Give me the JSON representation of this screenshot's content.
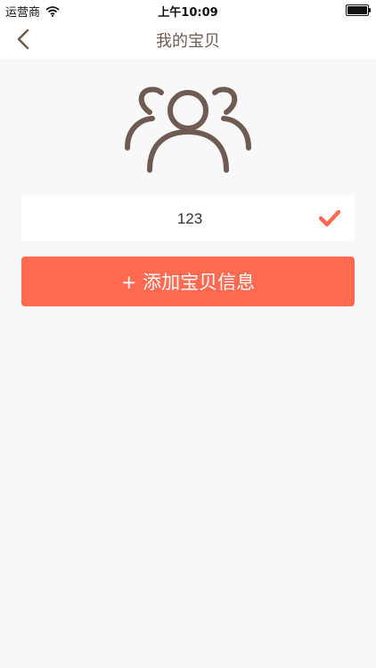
{
  "status_bar": {
    "carrier": "运营商",
    "time": "上午10:09",
    "wifi_icon": "wifi-icon",
    "battery_icon": "battery-icon"
  },
  "nav": {
    "title": "我的宝贝",
    "back_icon": "chevron-left-icon"
  },
  "hero": {
    "icon": "users-group-icon",
    "color": "#6f5b52"
  },
  "child_input": {
    "value": "123",
    "confirm_icon": "check-icon",
    "confirm_color": "#ff6a51"
  },
  "add_button": {
    "label": "+ 添加宝贝信息",
    "color": "#ff6a51"
  }
}
